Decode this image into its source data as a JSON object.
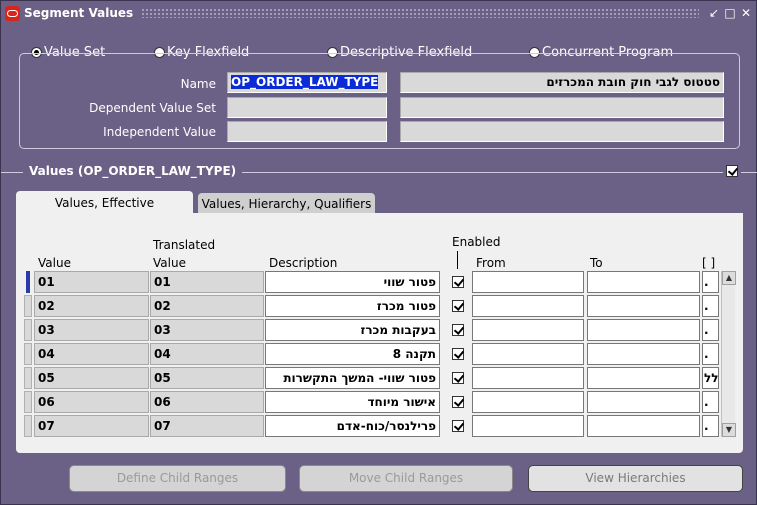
{
  "window": {
    "title": "Segment Values",
    "controls": [
      "✓",
      "✕"
    ]
  },
  "radios": [
    {
      "label": "Value Set",
      "selected": true
    },
    {
      "label": "Key Flexfield",
      "selected": false
    },
    {
      "label": "Descriptive Flexfield",
      "selected": false
    },
    {
      "label": "Concurrent Program",
      "selected": false
    }
  ],
  "form": {
    "name_label": "Name",
    "name_value": "OP_ORDER_LAW_TYPE",
    "name_description": "סטטוס לגבי חוק חובת המכרזים",
    "dependent_label": "Dependent Value Set",
    "dependent_value": "",
    "dependent_description": "",
    "independent_label": "Independent Value",
    "independent_value": "",
    "independent_description": ""
  },
  "values_section": {
    "title": "Values (OP_ORDER_LAW_TYPE)",
    "checked": true
  },
  "tabs": [
    {
      "label": "Values, Effective",
      "active": true
    },
    {
      "label": "Values, Hierarchy, Qualifiers",
      "active": false
    }
  ],
  "table": {
    "headers": {
      "value": "Value",
      "translated_1": "Translated",
      "translated_2": "Value",
      "description": "Description",
      "enabled": "Enabled",
      "from": "From",
      "to": "To",
      "flex": "[ ]"
    },
    "rows": [
      {
        "value": "01",
        "translated": "01",
        "description": "פטור שווי",
        "enabled": true,
        "from": "",
        "to": "",
        "flex": "."
      },
      {
        "value": "02",
        "translated": "02",
        "description": "פטור מכרז",
        "enabled": true,
        "from": "",
        "to": "",
        "flex": "."
      },
      {
        "value": "03",
        "translated": "03",
        "description": "בעקבות מכרז",
        "enabled": true,
        "from": "",
        "to": "",
        "flex": "."
      },
      {
        "value": "04",
        "translated": "04",
        "description": "תקנה 8",
        "enabled": true,
        "from": "",
        "to": "",
        "flex": "."
      },
      {
        "value": "05",
        "translated": "05",
        "description": "פטור שווי- המשך התקשרות",
        "enabled": true,
        "from": "",
        "to": "",
        "flex": "לל:"
      },
      {
        "value": "06",
        "translated": "06",
        "description": "אישור מיוחד",
        "enabled": true,
        "from": "",
        "to": "",
        "flex": "."
      },
      {
        "value": "07",
        "translated": "07",
        "description": "פרילנסר/כוח-אדם",
        "enabled": true,
        "from": "",
        "to": "",
        "flex": "."
      }
    ]
  },
  "buttons": {
    "define_child_ranges": "Define Child Ranges",
    "move_child_ranges": "Move Child Ranges",
    "view_hierarchies": "View Hierarchies"
  },
  "colors": {
    "window_bg": "#6b6186",
    "selection": "#0a2bd6",
    "field_bg": "#d9d9d9"
  }
}
